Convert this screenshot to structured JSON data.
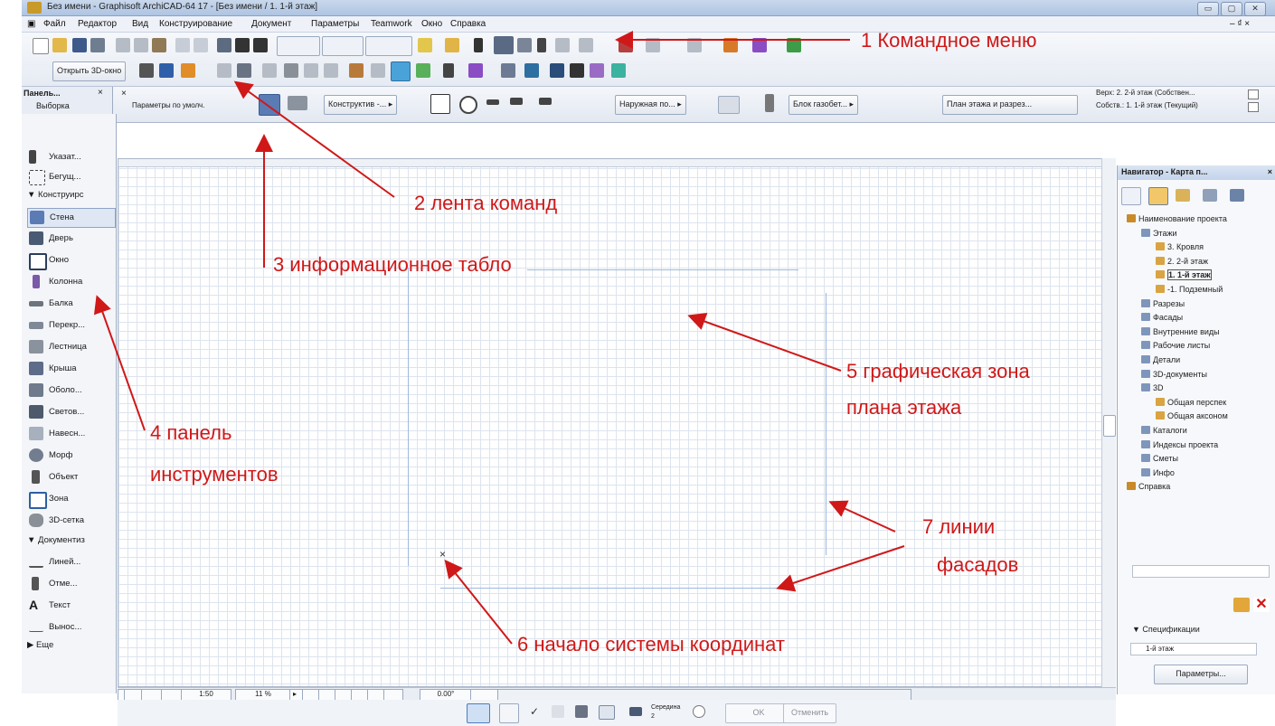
{
  "window": {
    "title": "Без имени - Graphisoft ArchiCAD-64 17 - [Без имени / 1. 1-й этаж]",
    "min": "▭",
    "max": "▢",
    "close": "✕"
  },
  "menu": {
    "items": [
      "Файл",
      "Редактор",
      "Вид",
      "Конструирование",
      "Документ",
      "Параметры",
      "Teamwork",
      "Окно",
      "Справка"
    ],
    "right": "– ₫ ×"
  },
  "toolbar": {
    "open3d": "Открыть 3D-окно"
  },
  "ribbon": {
    "left_panel_title": "Панель...",
    "left_panel_close": "×",
    "selection_label": "Выборка",
    "defaults_label": "Параметры по умолч.",
    "construct_btn": "Конструктив -...",
    "outer_btn": "Наружная по...",
    "block_btn": "Блок газобет...",
    "plan_btn": "План этажа и разрез...",
    "top_label": "Верх:",
    "top_value": "2. 2-й этаж (Собствен...",
    "own_label": "Собств.:",
    "own_value": "1. 1-й этаж (Текущий)"
  },
  "toolbox": {
    "items": [
      {
        "label": "Указат...",
        "icon": "arrow-pointer-icon"
      },
      {
        "label": "Бегущ...",
        "icon": "marquee-icon"
      }
    ],
    "group_construct": "▼ Конструирс",
    "construct_items": [
      {
        "label": "Стена",
        "icon": "wall-icon"
      },
      {
        "label": "Дверь",
        "icon": "door-icon"
      },
      {
        "label": "Окно",
        "icon": "window-icon"
      },
      {
        "label": "Колонна",
        "icon": "column-icon"
      },
      {
        "label": "Балка",
        "icon": "beam-icon"
      },
      {
        "label": "Перекр...",
        "icon": "slab-icon"
      },
      {
        "label": "Лестница",
        "icon": "stair-icon"
      },
      {
        "label": "Крыша",
        "icon": "roof-icon"
      },
      {
        "label": "Оболо...",
        "icon": "shell-icon"
      },
      {
        "label": "Светов...",
        "icon": "skylight-icon"
      },
      {
        "label": "Навесн...",
        "icon": "curtain-wall-icon"
      },
      {
        "label": "Морф",
        "icon": "morph-icon"
      },
      {
        "label": "Объект",
        "icon": "object-icon"
      },
      {
        "label": "Зона",
        "icon": "zone-icon"
      },
      {
        "label": "3D-сетка",
        "icon": "mesh-icon"
      }
    ],
    "group_doc": "▼ Документиз",
    "doc_items": [
      {
        "label": "Линей...",
        "icon": "dimension-icon"
      },
      {
        "label": "Отме...",
        "icon": "level-icon"
      },
      {
        "label": "Текст",
        "icon": "text-icon"
      },
      {
        "label": "Вынос...",
        "icon": "label-icon"
      }
    ],
    "more": "▶ Еще"
  },
  "navigator": {
    "title": "Навигатор - Карта п...",
    "close": "×",
    "tree": [
      {
        "label": "Наименование проекта",
        "level": 0
      },
      {
        "label": "Этажи",
        "level": 1
      },
      {
        "label": "3. Кровля",
        "level": 2
      },
      {
        "label": "2. 2-й этаж",
        "level": 2
      },
      {
        "label": "1. 1-й этаж",
        "level": 2
      },
      {
        "label": "-1. Подземный",
        "level": 2
      },
      {
        "label": "Разрезы",
        "level": 1
      },
      {
        "label": "Фасады",
        "level": 1
      },
      {
        "label": "Внутренние виды",
        "level": 1
      },
      {
        "label": "Рабочие листы",
        "level": 1
      },
      {
        "label": "Детали",
        "level": 1
      },
      {
        "label": "3D-документы",
        "level": 1
      },
      {
        "label": "3D",
        "level": 1
      },
      {
        "label": "Общая перспек",
        "level": 2
      },
      {
        "label": "Общая аксоном",
        "level": 2
      },
      {
        "label": "Каталоги",
        "level": 1
      },
      {
        "label": "Индексы проекта",
        "level": 1
      },
      {
        "label": "Сметы",
        "level": 1
      },
      {
        "label": "Инфо",
        "level": 1
      },
      {
        "label": "Справка",
        "level": 0
      }
    ],
    "spec_label": "▼ Спецификации",
    "floor_value": "1-й этаж",
    "params_btn": "Параметры..."
  },
  "bottombar": {
    "scale": "1:50",
    "zoom": "11 %",
    "angle": "0.00°"
  },
  "statusbar": {
    "mid": "Середина",
    "mid_num": "2",
    "ok": "OK",
    "cancel": "Отменить"
  },
  "annotations": {
    "a1": "1 Командное меню",
    "a2": "2 лента команд",
    "a3": "3 информационное табло",
    "a4a": "4 панель",
    "a4b": "инструментов",
    "a5a": "5 графическая зона",
    "a5b": "плана этажа",
    "a6": "6 начало системы координат",
    "a7a": "7 линии",
    "a7b": "фасадов"
  },
  "canvas": {
    "origin_mark": "×"
  },
  "colors": {
    "annotation": "#d01818",
    "accent": "#1d5fb8"
  }
}
